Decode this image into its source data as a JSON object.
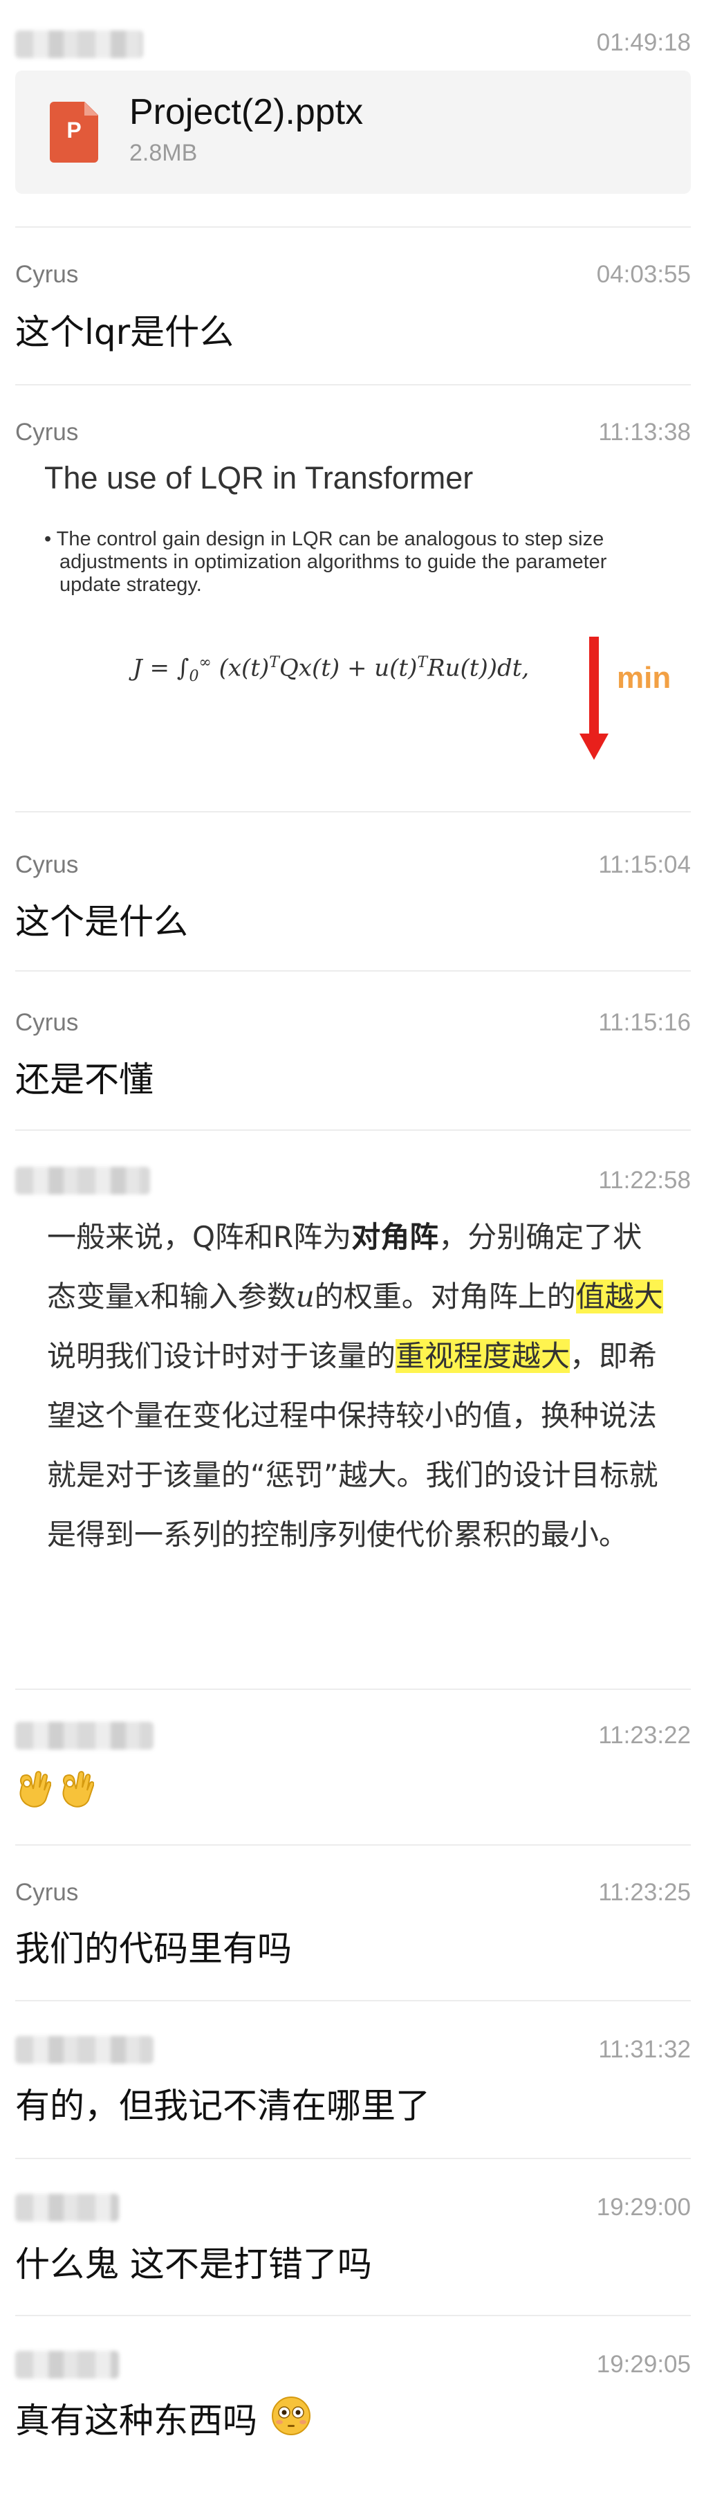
{
  "messages": [
    {
      "time": "01:49:18",
      "file": {
        "name": "Project(2).pptx",
        "size": "2.8MB",
        "icon_letter": "P",
        "icon": "ppt-file-icon"
      }
    },
    {
      "sender": "Cyrus",
      "time": "04:03:55",
      "text": "这个lqr是什么"
    },
    {
      "sender": "Cyrus",
      "time": "11:13:38",
      "slide": {
        "title": "The use of LQR in Transformer",
        "bullet": "• The control gain design in LQR can be analogous to step size adjustments in optimization algorithms to guide the parameter update strategy.",
        "formula_prefix": "J = ∫",
        "formula_lower": "0",
        "formula_upper": "∞",
        "formula_body1": " (x(t)",
        "formula_sup1": "T",
        "formula_body2": "Qx(t) + u(t)",
        "formula_sup2": "T",
        "formula_body3": "Ru(t))dt,",
        "annotation": "min",
        "arrow_color": "#e8201c",
        "annotation_color": "#f2a044"
      }
    },
    {
      "sender": "Cyrus",
      "time": "11:15:04",
      "text": "这个是什么"
    },
    {
      "sender": "Cyrus",
      "time": "11:15:16",
      "text": "还是不懂"
    },
    {
      "time": "11:22:58",
      "paragraph": {
        "p1": "一般来说，Q阵和R阵为",
        "b1": "对角阵",
        "p2": "，分别确定了状态变量",
        "v1": "x",
        "p3": "和输入参数",
        "v2": "u",
        "p4": "的权重。对角阵上的",
        "h1": "值越大",
        "p5": "说明我们设计时对于该量的",
        "h2": "重视程度越大",
        "p6": "，即希望这个量在变化过程中保持较小的值，换种说法就是对于该量的“惩罚”越大。我们的设计目标就是得到一系列的控制序列使代价累积的最小。"
      }
    },
    {
      "time": "11:23:22",
      "emoji": [
        "ok-hand-icon",
        "ok-hand-icon"
      ]
    },
    {
      "sender": "Cyrus",
      "time": "11:23:25",
      "text": "我们的代码里有吗"
    },
    {
      "time": "11:31:32",
      "text": "有的，但我记不清在哪里了"
    },
    {
      "time": "19:29:00",
      "text": "什么鬼 这不是打错了吗"
    },
    {
      "time": "19:29:05",
      "text": "真有这种东西吗",
      "emoji": "flushed-face-icon"
    }
  ],
  "colors": {
    "highlight": "#fff44f",
    "divider": "#ececec",
    "meta": "#a3a3a3"
  }
}
